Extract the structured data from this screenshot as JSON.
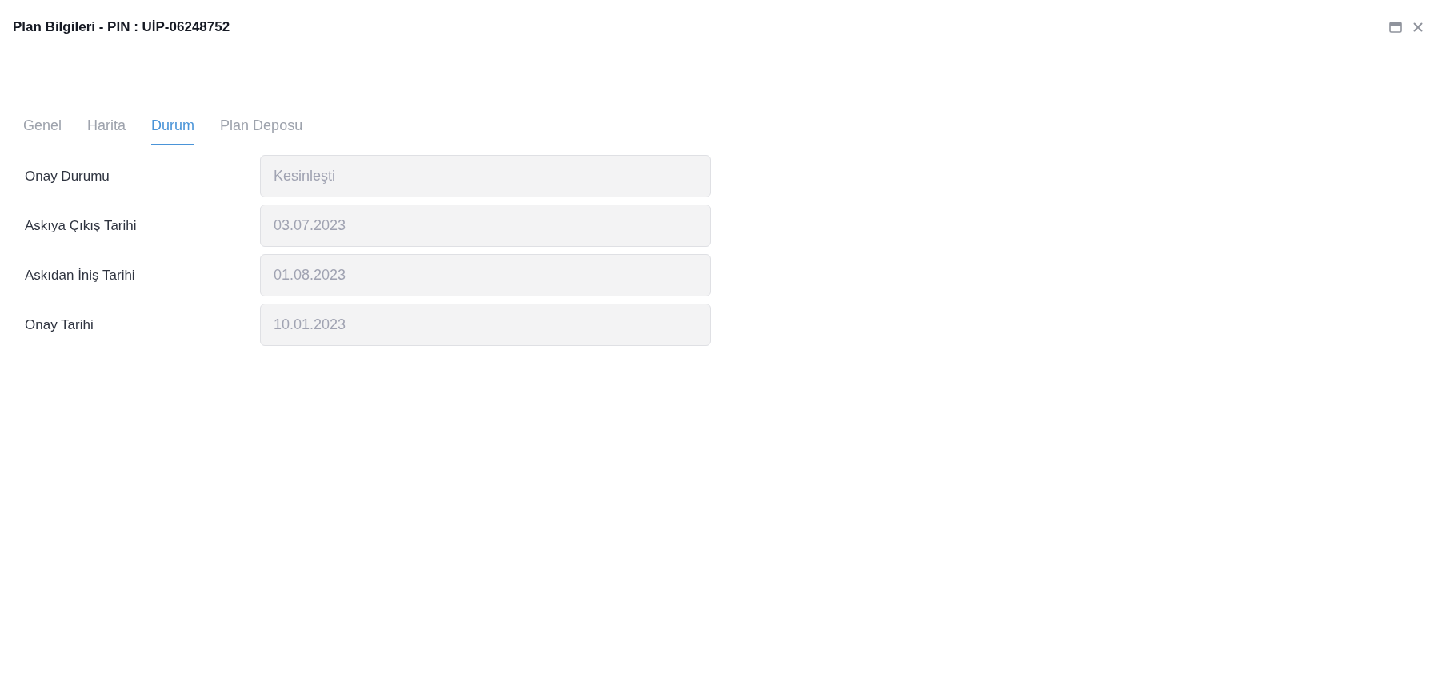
{
  "window": {
    "title": "Plan Bilgileri - PIN : UİP-06248752"
  },
  "tabs": [
    {
      "label": "Genel",
      "selected": false
    },
    {
      "label": "Harita",
      "selected": false
    },
    {
      "label": "Durum",
      "selected": true
    },
    {
      "label": "Plan Deposu",
      "selected": false
    }
  ],
  "fields": [
    {
      "label": "Onay Durumu",
      "value": "Kesinleşti",
      "disabled": true
    },
    {
      "label": "Askıya Çıkış Tarihi",
      "value": "03.07.2023",
      "disabled": true
    },
    {
      "label": "Askıdan İniş Tarihi",
      "value": "01.08.2023",
      "disabled": true
    },
    {
      "label": "Onay Tarihi",
      "value": "10.01.2023",
      "disabled": true
    }
  ]
}
